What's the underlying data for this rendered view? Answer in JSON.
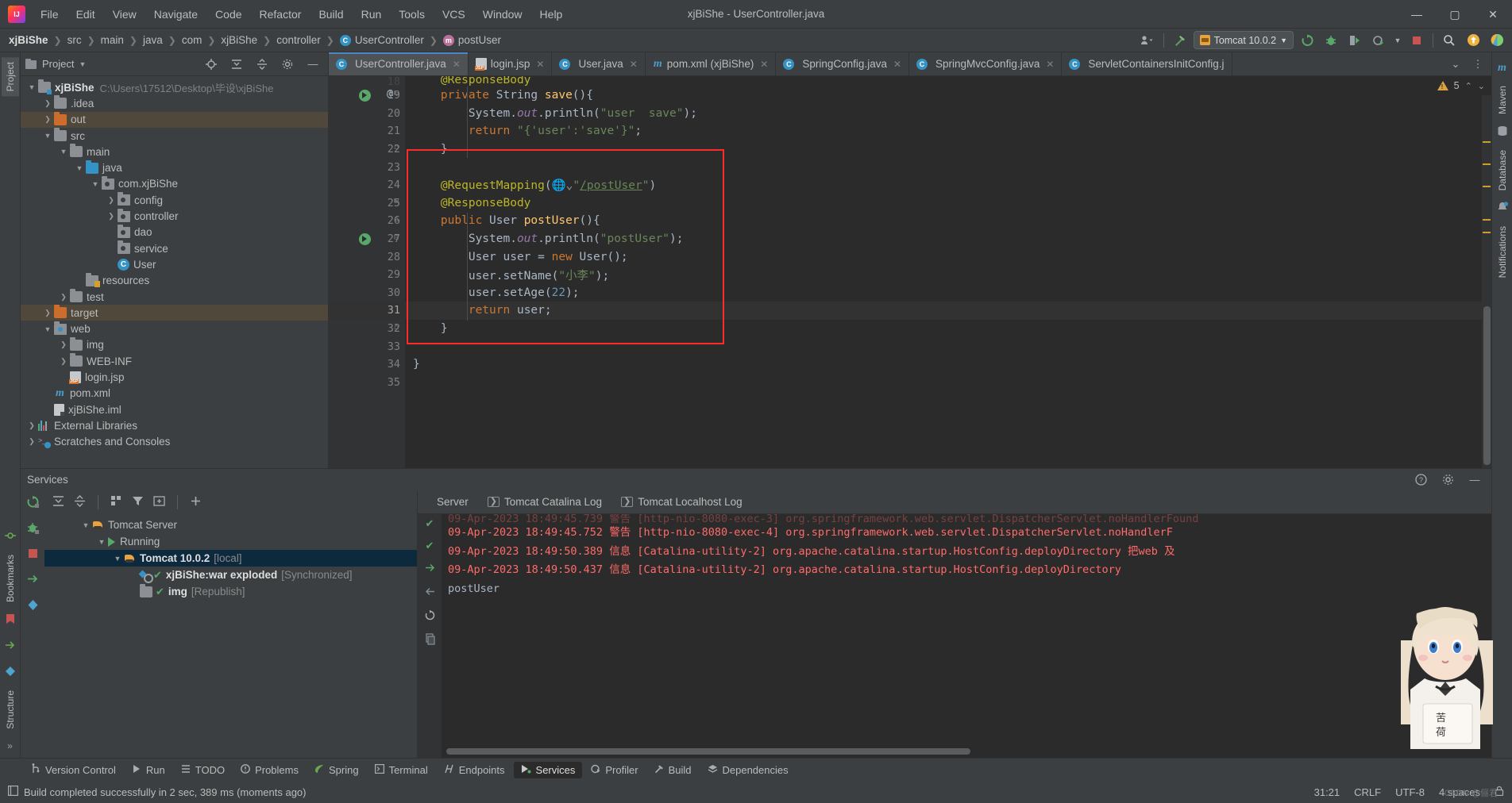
{
  "window": {
    "title": "xjBiShe - UserController.java",
    "minimize": "—",
    "maximize": "▢",
    "close": "✕"
  },
  "menubar": {
    "items": [
      "File",
      "Edit",
      "View",
      "Navigate",
      "Code",
      "Refactor",
      "Build",
      "Run",
      "Tools",
      "VCS",
      "Window",
      "Help"
    ]
  },
  "breadcrumb": {
    "items": [
      {
        "label": "xjBiShe",
        "icon": "",
        "bold": true
      },
      {
        "label": "src",
        "icon": ""
      },
      {
        "label": "main",
        "icon": ""
      },
      {
        "label": "java",
        "icon": ""
      },
      {
        "label": "com",
        "icon": ""
      },
      {
        "label": "xjBiShe",
        "icon": ""
      },
      {
        "label": "controller",
        "icon": ""
      },
      {
        "label": "UserController",
        "icon": "class-icon"
      },
      {
        "label": "postUser",
        "icon": "method-icon"
      }
    ]
  },
  "toolbar": {
    "run_config": "Tomcat 10.0.2",
    "icons": [
      "user-settings-icon",
      "build-hammer-icon",
      "rerun-icon",
      "debug-icon",
      "run-with-coverage-icon",
      "profile-icon",
      "stop-icon",
      "search-everywhere-icon",
      "update-icon",
      "ide-icon"
    ]
  },
  "project_panel": {
    "title": "Project",
    "header_icons": [
      "locate-icon",
      "expand-all-icon",
      "collapse-all-icon",
      "gear-icon",
      "hide-icon"
    ],
    "tree": [
      {
        "label": "xjBiShe",
        "path": "C:\\Users\\17512\\Desktop\\毕设\\xjBiShe",
        "indent": 0,
        "arrow": "v",
        "icon": "module-folder",
        "bold": true
      },
      {
        "label": ".idea",
        "indent": 1,
        "arrow": ">",
        "icon": "folder"
      },
      {
        "label": "out",
        "indent": 1,
        "arrow": ">",
        "icon": "folder-orange",
        "highlight": true
      },
      {
        "label": "src",
        "indent": 1,
        "arrow": "v",
        "icon": "folder"
      },
      {
        "label": "main",
        "indent": 2,
        "arrow": "v",
        "icon": "folder"
      },
      {
        "label": "java",
        "indent": 3,
        "arrow": "v",
        "icon": "folder-blue"
      },
      {
        "label": "com.xjBiShe",
        "indent": 4,
        "arrow": "v",
        "icon": "package"
      },
      {
        "label": "config",
        "indent": 5,
        "arrow": ">",
        "icon": "package"
      },
      {
        "label": "controller",
        "indent": 5,
        "arrow": ">",
        "icon": "package"
      },
      {
        "label": "dao",
        "indent": 5,
        "arrow": "",
        "icon": "package"
      },
      {
        "label": "service",
        "indent": 5,
        "arrow": "",
        "icon": "package"
      },
      {
        "label": "User",
        "indent": 5,
        "arrow": "",
        "icon": "class"
      },
      {
        "label": "resources",
        "indent": 3,
        "arrow": "",
        "icon": "resources-folder"
      },
      {
        "label": "test",
        "indent": 2,
        "arrow": ">",
        "icon": "folder"
      },
      {
        "label": "target",
        "indent": 1,
        "arrow": ">",
        "icon": "folder-orange",
        "highlight": true
      },
      {
        "label": "web",
        "indent": 1,
        "arrow": "v",
        "icon": "web-folder"
      },
      {
        "label": "img",
        "indent": 2,
        "arrow": ">",
        "icon": "folder"
      },
      {
        "label": "WEB-INF",
        "indent": 2,
        "arrow": ">",
        "icon": "folder"
      },
      {
        "label": "login.jsp",
        "indent": 2,
        "arrow": "",
        "icon": "jsp"
      },
      {
        "label": "pom.xml",
        "indent": 1,
        "arrow": "",
        "icon": "maven"
      },
      {
        "label": "xjBiShe.iml",
        "indent": 1,
        "arrow": "",
        "icon": "iml"
      },
      {
        "label": "External Libraries",
        "indent": 0,
        "arrow": ">",
        "icon": "library"
      },
      {
        "label": "Scratches and Consoles",
        "indent": 0,
        "arrow": ">",
        "icon": "scratches"
      }
    ]
  },
  "left_strip": {
    "tabs": [
      "Project",
      "Bookmarks",
      "Structure"
    ],
    "icons": [
      "commit-icon",
      "bookmarks-icon",
      "structure-icon",
      "more-icon"
    ]
  },
  "right_strip": {
    "tabs": [
      "Maven",
      "Database",
      "Notifications"
    ]
  },
  "editor": {
    "tabs": [
      {
        "label": "UserController.java",
        "icon": "class-icon",
        "active": true
      },
      {
        "label": "login.jsp",
        "icon": "jsp-icon",
        "active": false
      },
      {
        "label": "User.java",
        "icon": "class-icon",
        "active": false
      },
      {
        "label": "pom.xml (xjBiShe)",
        "icon": "maven-icon",
        "active": false
      },
      {
        "label": "SpringConfig.java",
        "icon": "class-icon",
        "active": false
      },
      {
        "label": "SpringMvcConfig.java",
        "icon": "class-icon",
        "active": false
      },
      {
        "label": "ServletContainersInitConfig.j",
        "icon": "class-icon",
        "active": false
      }
    ],
    "tab_close": "✕",
    "tabs_overflow": "⌄",
    "tabs_more": "⋮",
    "warning_count": "5",
    "lines": [
      {
        "num": "18",
        "partial": true
      },
      {
        "num": "19",
        "run_marker": true,
        "at": "@"
      },
      {
        "num": "20"
      },
      {
        "num": "21"
      },
      {
        "num": "22"
      },
      {
        "num": "23"
      },
      {
        "num": "24"
      },
      {
        "num": "25"
      },
      {
        "num": "26",
        "run_marker": true
      },
      {
        "num": "27"
      },
      {
        "num": "28"
      },
      {
        "num": "29"
      },
      {
        "num": "30"
      },
      {
        "num": "31",
        "current": true
      },
      {
        "num": "32"
      },
      {
        "num": "33"
      },
      {
        "num": "34"
      },
      {
        "num": "35"
      }
    ],
    "code_text": [
      "    @ResponseBody",
      "    private String save(){",
      "        System.out.println(\"user  save\");",
      "        return \"{'user':'save'}\";",
      "    }",
      "",
      "    @RequestMapping(\"/postUser\")",
      "    @ResponseBody",
      "    public User postUser(){",
      "        System.out.println(\"postUser\");",
      "        User user = new User();",
      "        user.setName(\"小李\");",
      "        user.setAge(22);",
      "        return user;",
      "    }",
      "",
      "}",
      ""
    ]
  },
  "services": {
    "title": "Services",
    "header_icons": [
      "help-icon",
      "gear-icon",
      "hide-icon"
    ],
    "toolbar_icons": [
      "expand-all-icon",
      "collapse-all-icon",
      "group-icon",
      "filter-icon",
      "add-frame-icon",
      "add-icon"
    ],
    "side_icons": [
      "rerun-icon",
      "debug-icon",
      "stop-icon",
      "deploy-icon",
      "artifacts-icon"
    ],
    "tree": [
      {
        "label": "Tomcat Server",
        "indent": 0,
        "arrow": "v",
        "icon": "tomcat-icon"
      },
      {
        "label": "Running",
        "indent": 1,
        "arrow": "v",
        "icon": "play-icon"
      },
      {
        "label": "Tomcat 10.0.2",
        "note": "[local]",
        "indent": 2,
        "arrow": "v",
        "icon": "tomcat-icon",
        "selected": true,
        "bold": true
      },
      {
        "label": "xjBiShe:war exploded",
        "note": "[Synchronized]",
        "indent": 3,
        "arrow": "",
        "icon": "artifact-icon",
        "check": true,
        "bold": true
      },
      {
        "label": "img",
        "note": "[Republish]",
        "indent": 3,
        "arrow": "",
        "icon": "folder-icon",
        "check": true,
        "bold": true
      }
    ],
    "console_tabs": [
      {
        "label": "Server",
        "active": true,
        "icon": ""
      },
      {
        "label": "Tomcat Catalina Log",
        "active": false,
        "icon": "log-icon"
      },
      {
        "label": "Tomcat Localhost Log",
        "active": false,
        "icon": "log-icon"
      }
    ],
    "console_lines": [
      {
        "text": "09-Apr-2023 18:49:45.739 警告 [http-nio-8080-exec-3] org.springframework.web.servlet.DispatcherServlet.noHandlerFound",
        "type": "error",
        "partial": true
      },
      {
        "text": "09-Apr-2023 18:49:45.752 警告 [http-nio-8080-exec-4] org.springframework.web.servlet.DispatcherServlet.noHandlerF",
        "type": "error"
      },
      {
        "text": "09-Apr-2023 18:49:50.389 信息 [Catalina-utility-2] org.apache.catalina.startup.HostConfig.deployDirectory 把web 及",
        "type": "error"
      },
      {
        "text": "09-Apr-2023 18:49:50.437 信息 [Catalina-utility-2] org.apache.catalina.startup.HostConfig.deployDirectory",
        "type": "error"
      },
      {
        "text": "postUser",
        "type": "plain"
      }
    ]
  },
  "toolwindow_bar": {
    "items": [
      {
        "label": "Version Control",
        "icon": "branch-icon",
        "active": false
      },
      {
        "label": "Run",
        "icon": "play-icon",
        "active": false
      },
      {
        "label": "TODO",
        "icon": "list-icon",
        "active": false
      },
      {
        "label": "Problems",
        "icon": "problems-icon",
        "active": false
      },
      {
        "label": "Spring",
        "icon": "spring-leaf-icon",
        "active": false
      },
      {
        "label": "Terminal",
        "icon": "terminal-icon",
        "active": false
      },
      {
        "label": "Endpoints",
        "icon": "endpoints-icon",
        "active": false
      },
      {
        "label": "Services",
        "icon": "services-icon",
        "active": true
      },
      {
        "label": "Profiler",
        "icon": "profiler-icon",
        "active": false
      },
      {
        "label": "Build",
        "icon": "hammer-icon",
        "active": false
      },
      {
        "label": "Dependencies",
        "icon": "dependencies-icon",
        "active": false
      }
    ]
  },
  "statusbar": {
    "message": "Build completed successfully in 2 sec, 389 ms (moments ago)",
    "message_icon": "build-status-icon",
    "caret_position": "31:21",
    "line_separator": "CRLF",
    "encoding": "UTF-8",
    "indent": "4 spaces",
    "lock_icon": "lock-icon",
    "watermark": "CSDN @俪君"
  },
  "colors": {
    "accent_blue": "#4a88c7",
    "keyword_orange": "#cc7832",
    "string_green": "#6a8759",
    "annotation_yellow": "#bbb529",
    "method_yellow": "#ffc66d",
    "number_blue": "#6897bb",
    "error_red": "#ff6b68",
    "highlight_box_red": "#ff2a2a",
    "selection_blue": "#0d293e"
  }
}
